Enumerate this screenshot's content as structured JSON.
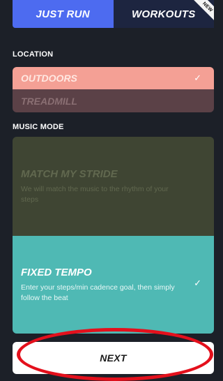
{
  "tabs": [
    {
      "label": "JUST RUN",
      "active": true
    },
    {
      "label": "WORKOUTS",
      "active": false,
      "badge": "NEW"
    }
  ],
  "location": {
    "label": "LOCATION",
    "options": [
      {
        "label": "OUTDOORS",
        "selected": true
      },
      {
        "label": "TREADMILL",
        "selected": false
      }
    ]
  },
  "music_mode": {
    "label": "MUSIC MODE",
    "options": [
      {
        "title": "MATCH MY STRIDE",
        "description": "We will match the music to the rhythm of your steps",
        "selected": false
      },
      {
        "title": "FIXED TEMPO",
        "description": "Enter your steps/min cadence goal, then simply follow the beat",
        "selected": true
      }
    ]
  },
  "next_button": {
    "label": "NEXT"
  },
  "icons": {
    "check": "✓"
  },
  "colors": {
    "background": "#1c2028",
    "tab_active": "#4d6bf0",
    "outdoors_selected": "#f4a095",
    "fixed_tempo_selected": "#4fb9b4",
    "annotation": "#e4101c"
  }
}
